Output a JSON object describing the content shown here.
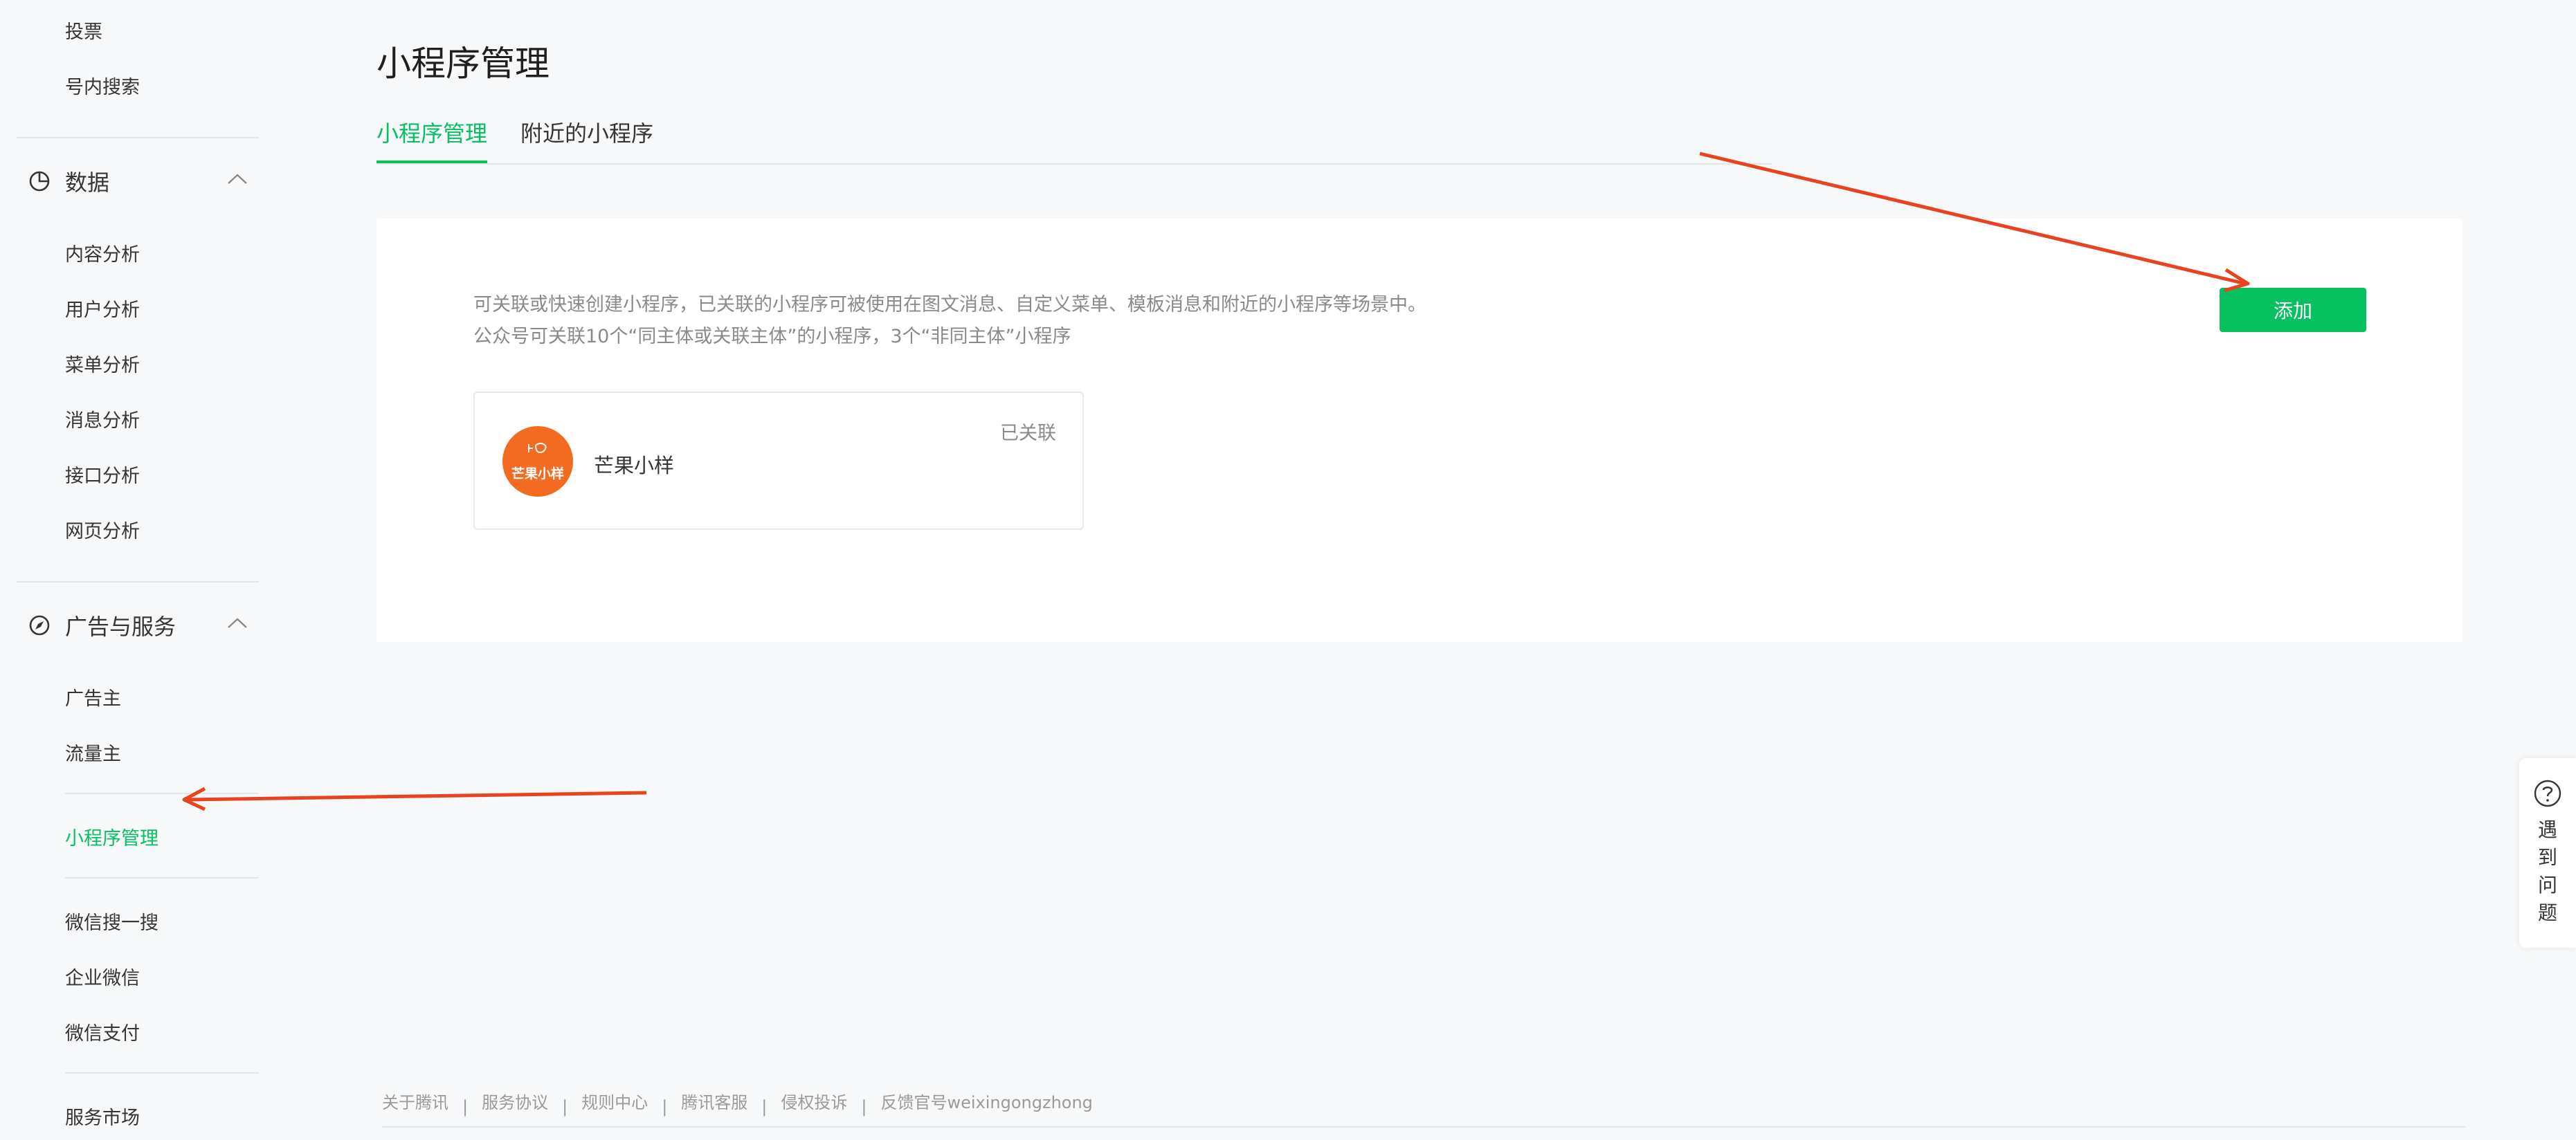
{
  "sidebar": {
    "top_items": [
      "投票",
      "号内搜索"
    ],
    "data_section": {
      "label": "数据",
      "icon": "pie-chart-icon",
      "items": [
        "内容分析",
        "用户分析",
        "菜单分析",
        "消息分析",
        "接口分析",
        "网页分析"
      ]
    },
    "ads_section": {
      "label": "广告与服务",
      "icon": "compass-icon",
      "items": [
        "广告主",
        "流量主",
        "小程序管理",
        "微信搜一搜",
        "企业微信",
        "微信支付",
        "服务市场"
      ]
    }
  },
  "page": {
    "title": "小程序管理",
    "tabs": [
      {
        "label": "小程序管理",
        "active": true
      },
      {
        "label": "附近的小程序",
        "active": false
      }
    ]
  },
  "panel": {
    "desc_line1": "可关联或快速创建小程序，已关联的小程序可被使用在图文消息、自定义菜单、模板消息和附近的小程序等场景中。",
    "desc_line2": "公众号可关联10个“同主体或关联主体”的小程序，3个“非同主体”小程序",
    "add_button": "添加",
    "card": {
      "logo_text": "芒果小样",
      "name": "芒果小样",
      "status": "已关联"
    }
  },
  "footer": {
    "links": [
      "关于腾讯",
      "服务协议",
      "规则中心",
      "腾讯客服",
      "侵权投诉",
      "反馈官号weixingongzhong"
    ]
  },
  "help": {
    "icon": "question-circle-icon",
    "chars": [
      "遇",
      "到",
      "问",
      "题"
    ]
  },
  "colors": {
    "accent": "#07c160",
    "annotation_arrow": "#e8431e",
    "logo_bg": "#f26b21"
  }
}
